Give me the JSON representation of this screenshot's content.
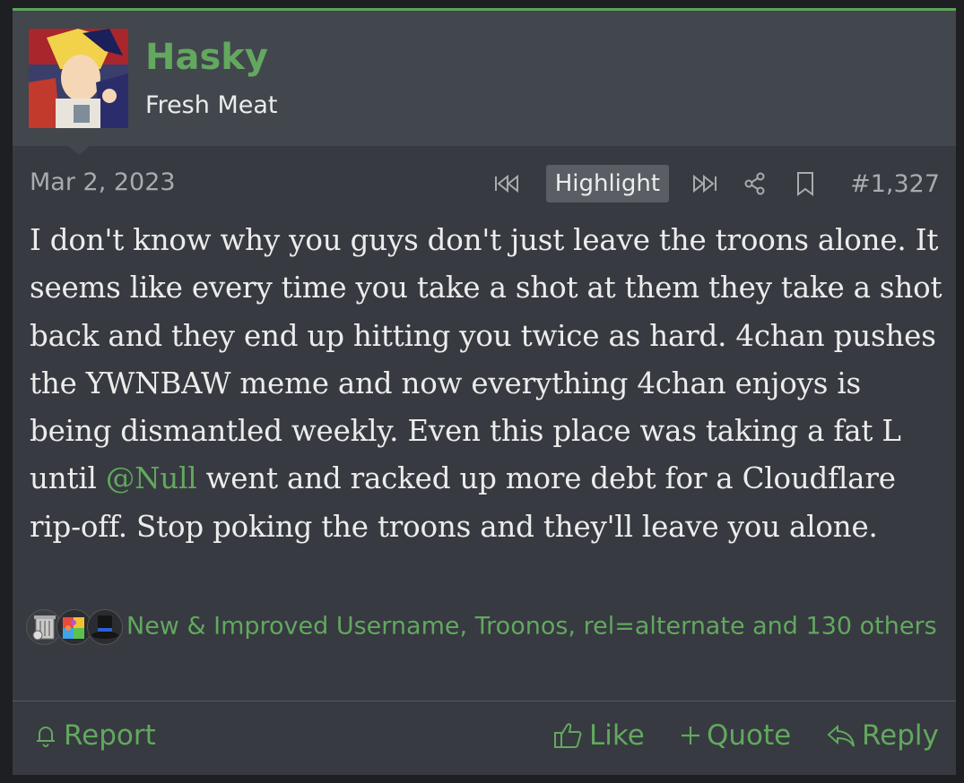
{
  "user": {
    "name": "Hasky",
    "title": "Fresh Meat"
  },
  "meta": {
    "date": "Mar 2, 2023",
    "highlight_label": "Highlight",
    "post_number": "#1,327"
  },
  "post": {
    "text_before_mention": "I don't know why you guys don't just leave the troons alone. It seems like every time you take a shot at them they take a shot back and they end up hitting you twice as hard. 4chan pushes the YWNBAW meme and now everything 4chan enjoys is being dismantled weekly. Even this place was taking a fat L until ",
    "mention": "@Null",
    "text_after_mention": " went and racked up more debt for a Cloudflare rip-off. Stop poking the troons and they'll leave you alone."
  },
  "reactions": {
    "icons": [
      "trash-can-icon",
      "puzzle-icon",
      "top-hat-icon"
    ],
    "text": "New & Improved Username, Troonos, rel=alternate and 130 others"
  },
  "footer": {
    "report_label": "Report",
    "like_label": "Like",
    "quote_label": "Quote",
    "reply_label": "Reply"
  },
  "colors": {
    "accent": "#62a85f",
    "background": "#373a40",
    "header_background": "#42464d",
    "text": "#ececec",
    "muted_text": "#a8abb0"
  }
}
